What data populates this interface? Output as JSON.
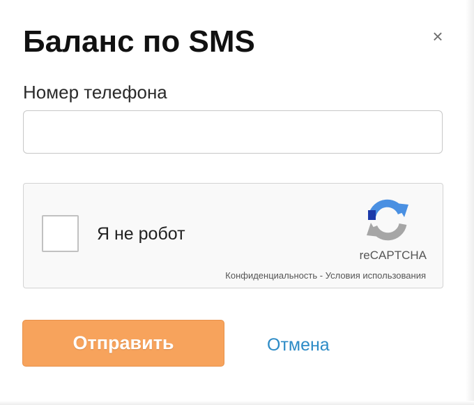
{
  "dialog": {
    "title": "Баланс по SMS",
    "close_glyph": "×",
    "close_icon": "close-icon"
  },
  "form": {
    "phone_label": "Номер телефона",
    "phone_value": "",
    "phone_placeholder": ""
  },
  "recaptcha": {
    "checkbox_label": "Я не робот",
    "brand": "reCAPTCHA",
    "privacy_link": "Конфиденциальность",
    "separator": " - ",
    "terms_link": "Условия использования",
    "logo_icon": "recaptcha-logo-icon",
    "checked": false
  },
  "actions": {
    "submit_label": "Отправить",
    "cancel_label": "Отмена"
  },
  "colors": {
    "submit_bg": "#f7a35c",
    "link": "#2d8bc6",
    "recaptcha_blue": "#4a90e2",
    "recaptcha_gray": "#a6a6a6"
  }
}
